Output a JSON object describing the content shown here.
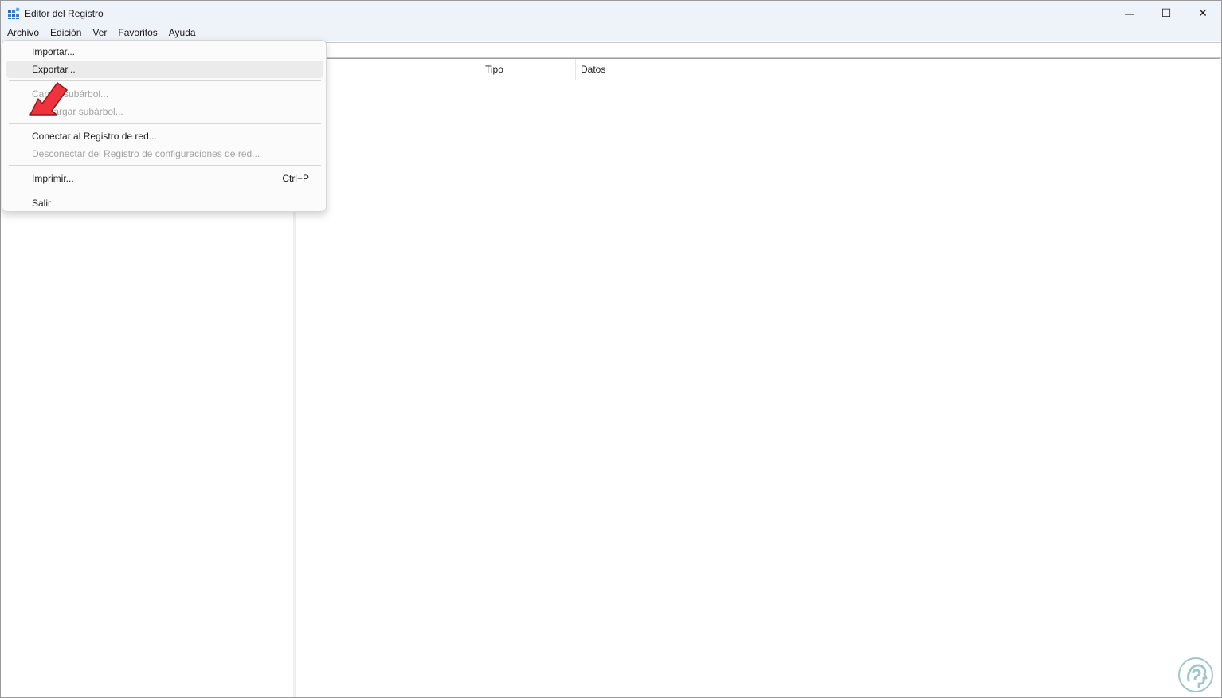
{
  "window": {
    "title": "Editor del Registro"
  },
  "window_controls": {
    "minimize": "—",
    "maximize": "☐",
    "close": "✕"
  },
  "menubar": [
    {
      "label": "Archivo"
    },
    {
      "label": "Edición"
    },
    {
      "label": "Ver"
    },
    {
      "label": "Favoritos"
    },
    {
      "label": "Ayuda"
    }
  ],
  "list": {
    "columns": [
      {
        "label": "re"
      },
      {
        "label": "Tipo"
      },
      {
        "label": "Datos"
      }
    ]
  },
  "file_menu": {
    "items": [
      {
        "label": "Importar...",
        "enabled": true
      },
      {
        "label": "Exportar...",
        "enabled": true,
        "highlighted": true
      },
      {
        "label": "Cargar subárbol...",
        "enabled": false
      },
      {
        "label": "Descargar subárbol...",
        "enabled": false
      },
      {
        "label": "Conectar al Registro de red...",
        "enabled": true
      },
      {
        "label": "Desconectar del Registro de configuraciones de red...",
        "enabled": false
      },
      {
        "label": "Imprimir...",
        "enabled": true,
        "shortcut": "Ctrl+P"
      },
      {
        "label": "Salir",
        "enabled": true
      }
    ]
  },
  "icons": {
    "app": "registry-editor-icon",
    "annotation": "red-arrow-pointer-icon",
    "watermark": "site-logo-icon"
  },
  "colors": {
    "titlebar_bg": "#eef3f9",
    "menu_hover_bg": "#ebebeb",
    "disabled_text": "#a3a3a3",
    "arrow_red": "#f0323c",
    "logo_teal": "#9ec7c9",
    "app_icon_blue": "#1f6fd1"
  }
}
